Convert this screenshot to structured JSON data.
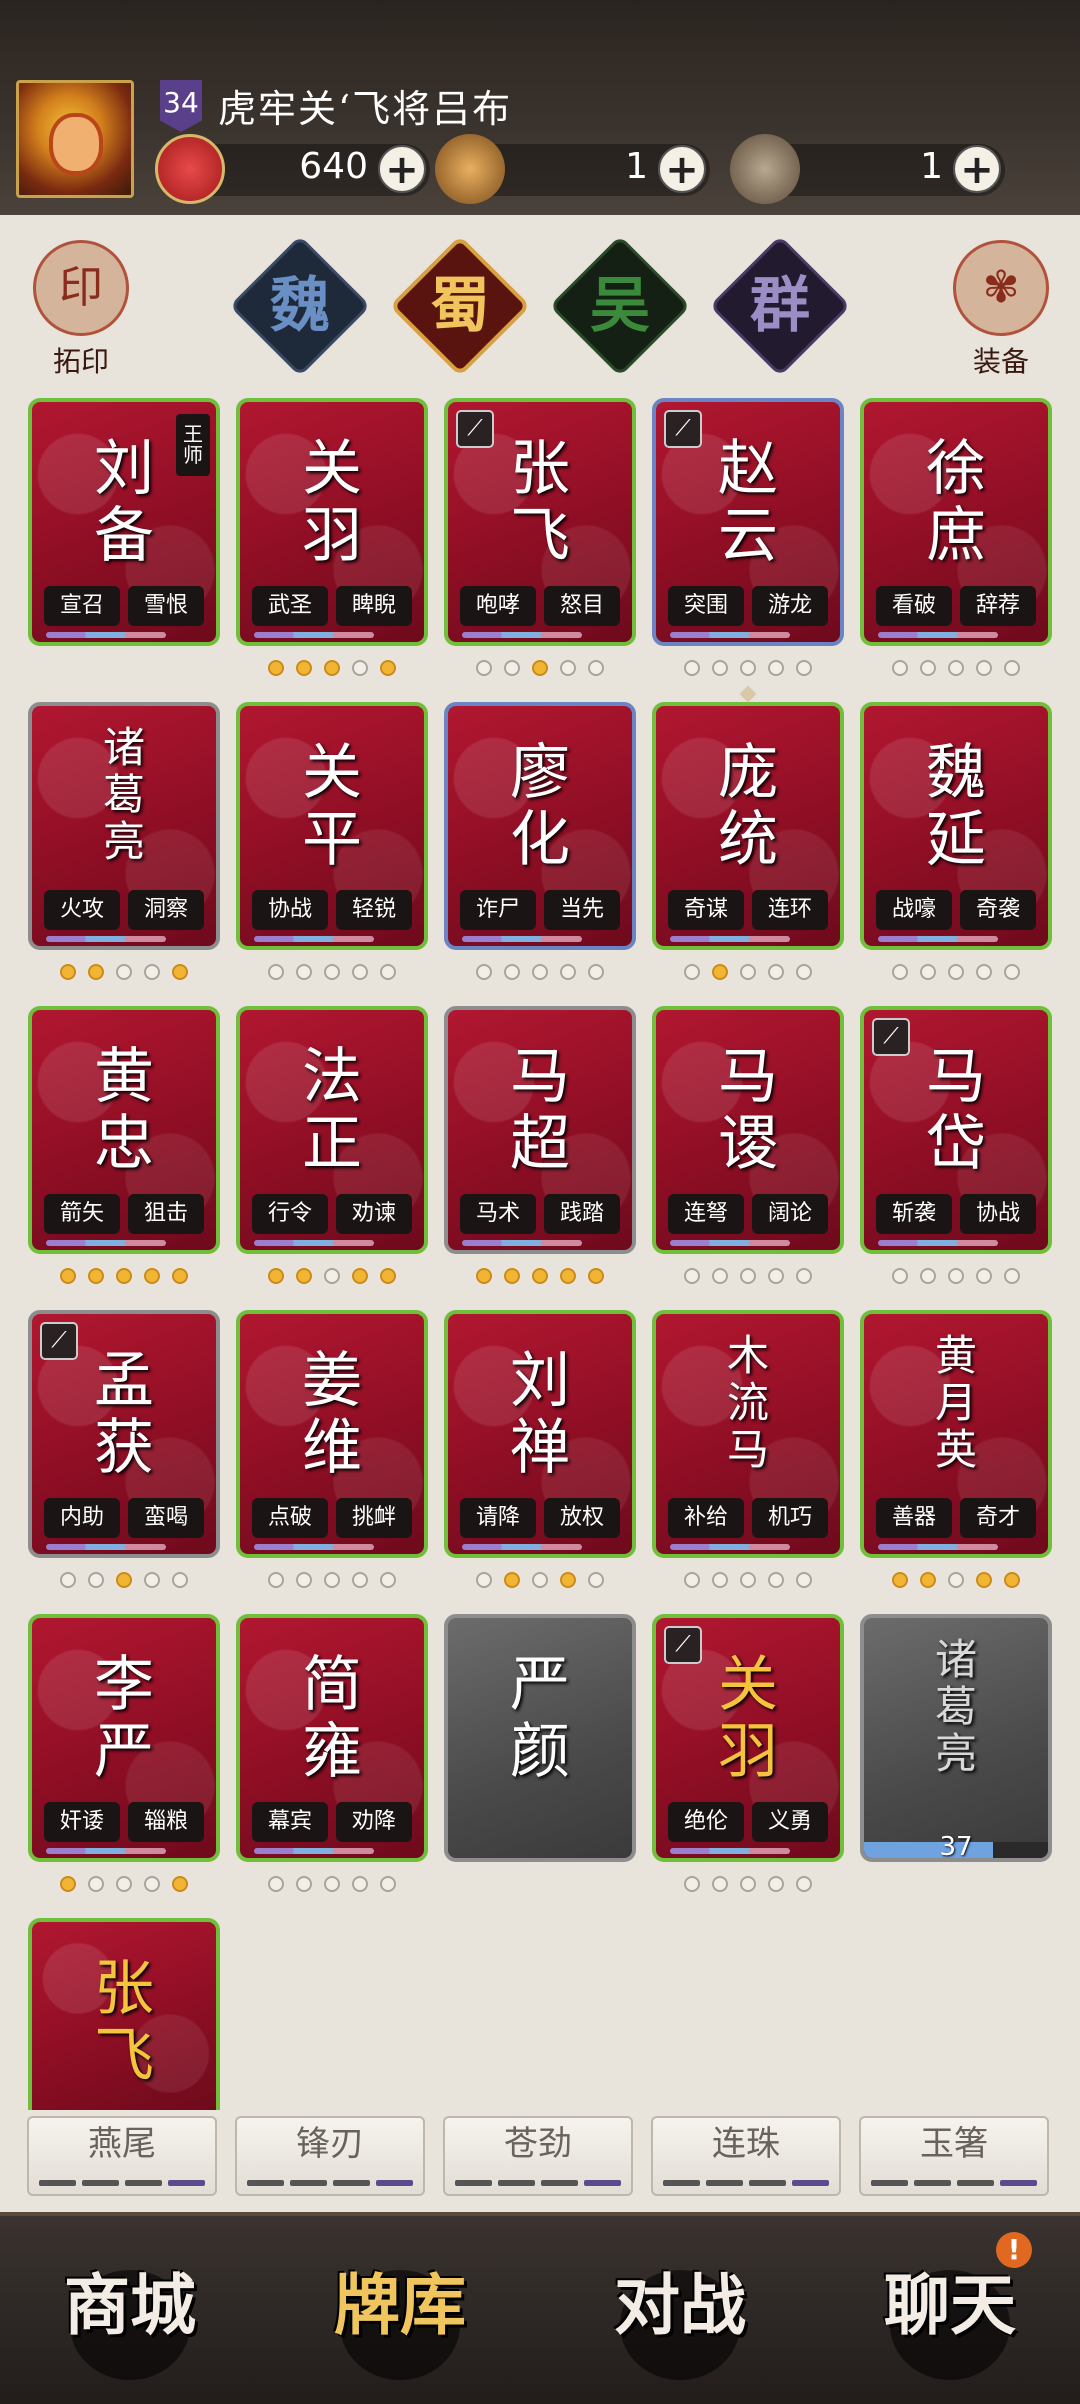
{
  "header": {
    "level": "34",
    "player_name": "虎牢关‘飞将吕布",
    "resources": [
      {
        "icon": "crossed-swords-icon",
        "value": "640"
      },
      {
        "icon": "scroll-pouch-icon",
        "value": "1"
      },
      {
        "icon": "bronze-orb-icon",
        "value": "1"
      }
    ],
    "plus": "+"
  },
  "side": {
    "left_glyph": "印",
    "left_label": "拓印",
    "right_label": "装备"
  },
  "factions": [
    {
      "label": "魏",
      "color": "#6a8fc4"
    },
    {
      "label": "蜀",
      "color": "#f1c55e"
    },
    {
      "label": "吴",
      "color": "#3b8a3b"
    },
    {
      "label": "群",
      "color": "#9b8ec4"
    }
  ],
  "cards": [
    {
      "name": [
        "刘",
        "备"
      ],
      "skills": [
        "宣召",
        "雪恨"
      ],
      "badge": [
        "王",
        "师"
      ],
      "frame": "green",
      "stars": 0
    },
    {
      "name": [
        "关",
        "羽"
      ],
      "skills": [
        "武圣",
        "睥睨"
      ],
      "frame": "green",
      "stars": 5,
      "star_pattern": [
        1,
        1,
        1,
        0,
        1
      ]
    },
    {
      "name": [
        "张",
        "飞"
      ],
      "skills": [
        "咆哮",
        "怒目"
      ],
      "frame": "green",
      "weapon": true,
      "star_pattern": [
        0,
        0,
        1,
        0,
        0
      ]
    },
    {
      "name": [
        "赵",
        "云"
      ],
      "skills": [
        "突围",
        "游龙"
      ],
      "frame": "blue",
      "weapon": true,
      "star_pattern": [
        0,
        0,
        0,
        0,
        0
      ]
    },
    {
      "name": [
        "徐",
        "庶"
      ],
      "skills": [
        "看破",
        "辞荐"
      ],
      "frame": "green",
      "star_pattern": [
        0,
        0,
        0,
        0,
        0
      ]
    },
    {
      "name": [
        "诸",
        "葛",
        "亮"
      ],
      "skills": [
        "火攻",
        "洞察"
      ],
      "frame": "grey",
      "star_pattern": [
        1,
        1,
        0,
        0,
        1
      ]
    },
    {
      "name": [
        "关",
        "平"
      ],
      "skills": [
        "协战",
        "轻锐"
      ],
      "frame": "green",
      "star_pattern": [
        0,
        0,
        0,
        0,
        0
      ]
    },
    {
      "name": [
        "廖",
        "化"
      ],
      "skills": [
        "诈尸",
        "当先"
      ],
      "frame": "blue",
      "star_pattern": [
        0,
        0,
        0,
        0,
        0
      ]
    },
    {
      "name": [
        "庞",
        "统"
      ],
      "skills": [
        "奇谋",
        "连环"
      ],
      "frame": "green",
      "star_pattern": [
        0,
        1,
        0,
        0,
        0
      ],
      "diamond": true
    },
    {
      "name": [
        "魏",
        "延"
      ],
      "skills": [
        "战嚎",
        "奇袭"
      ],
      "frame": "green",
      "star_pattern": [
        0,
        0,
        0,
        0,
        0
      ]
    },
    {
      "name": [
        "黄",
        "忠"
      ],
      "skills": [
        "箭矢",
        "狙击"
      ],
      "frame": "green",
      "star_pattern": [
        1,
        1,
        1,
        1,
        1
      ]
    },
    {
      "name": [
        "法",
        "正"
      ],
      "skills": [
        "行令",
        "劝谏"
      ],
      "frame": "green",
      "star_pattern": [
        1,
        1,
        0,
        1,
        1
      ]
    },
    {
      "name": [
        "马",
        "超"
      ],
      "skills": [
        "马术",
        "践踏"
      ],
      "frame": "grey",
      "star_pattern": [
        1,
        1,
        1,
        1,
        1
      ]
    },
    {
      "name": [
        "马",
        "谡"
      ],
      "skills": [
        "连弩",
        "阔论"
      ],
      "frame": "green",
      "star_pattern": [
        0,
        0,
        0,
        0,
        0
      ]
    },
    {
      "name": [
        "马",
        "岱"
      ],
      "skills": [
        "斩袭",
        "协战"
      ],
      "frame": "green",
      "weapon": true,
      "star_pattern": [
        0,
        0,
        0,
        0,
        0
      ]
    },
    {
      "name": [
        "孟",
        "获"
      ],
      "skills": [
        "内助",
        "蛮喝"
      ],
      "frame": "grey",
      "weapon": true,
      "star_pattern": [
        0,
        0,
        1,
        0,
        0
      ]
    },
    {
      "name": [
        "姜",
        "维"
      ],
      "skills": [
        "点破",
        "挑衅"
      ],
      "frame": "green",
      "star_pattern": [
        0,
        0,
        0,
        0,
        0
      ]
    },
    {
      "name": [
        "刘",
        "禅"
      ],
      "skills": [
        "请降",
        "放权"
      ],
      "frame": "green",
      "star_pattern": [
        0,
        1,
        0,
        1,
        0
      ]
    },
    {
      "name": [
        "木",
        "流",
        "马"
      ],
      "skills": [
        "补给",
        "机巧"
      ],
      "frame": "green",
      "star_pattern": [
        0,
        0,
        0,
        0,
        0
      ]
    },
    {
      "name": [
        "黄",
        "月",
        "英"
      ],
      "skills": [
        "善器",
        "奇才"
      ],
      "frame": "green",
      "star_pattern": [
        1,
        1,
        0,
        1,
        1
      ]
    },
    {
      "name": [
        "李",
        "严"
      ],
      "skills": [
        "奸诿",
        "辎粮"
      ],
      "frame": "green",
      "star_pattern": [
        1,
        0,
        0,
        0,
        1
      ]
    },
    {
      "name": [
        "简",
        "雍"
      ],
      "skills": [
        "幕宾",
        "劝降"
      ],
      "frame": "green",
      "star_pattern": [
        0,
        0,
        0,
        0,
        0
      ]
    },
    {
      "name": [
        "严",
        "颜"
      ],
      "skills": [],
      "frame": "dark",
      "star_pattern": null
    },
    {
      "name": [
        "关",
        "羽"
      ],
      "skills": [
        "绝伦",
        "义勇"
      ],
      "frame": "green",
      "weapon": true,
      "gold": true,
      "star_pattern": [
        0,
        0,
        0,
        0,
        0
      ]
    },
    {
      "name": [
        "诸",
        "葛",
        "亮"
      ],
      "skills": [],
      "frame": "dark",
      "faded": true,
      "progress": "37",
      "progress_fraction": 0.7,
      "star_pattern": null
    },
    {
      "name": [
        "张",
        "飞"
      ],
      "skills": [],
      "frame": "green",
      "gold": true,
      "partial": true,
      "star_pattern": null
    }
  ],
  "gems": [
    "燕尾",
    "锋刃",
    "苍劲",
    "连珠",
    "玉箸"
  ],
  "nav": [
    {
      "label": "商城"
    },
    {
      "label": "牌库",
      "active": true
    },
    {
      "label": "对战"
    },
    {
      "label": "聊天",
      "badge": "!"
    }
  ]
}
